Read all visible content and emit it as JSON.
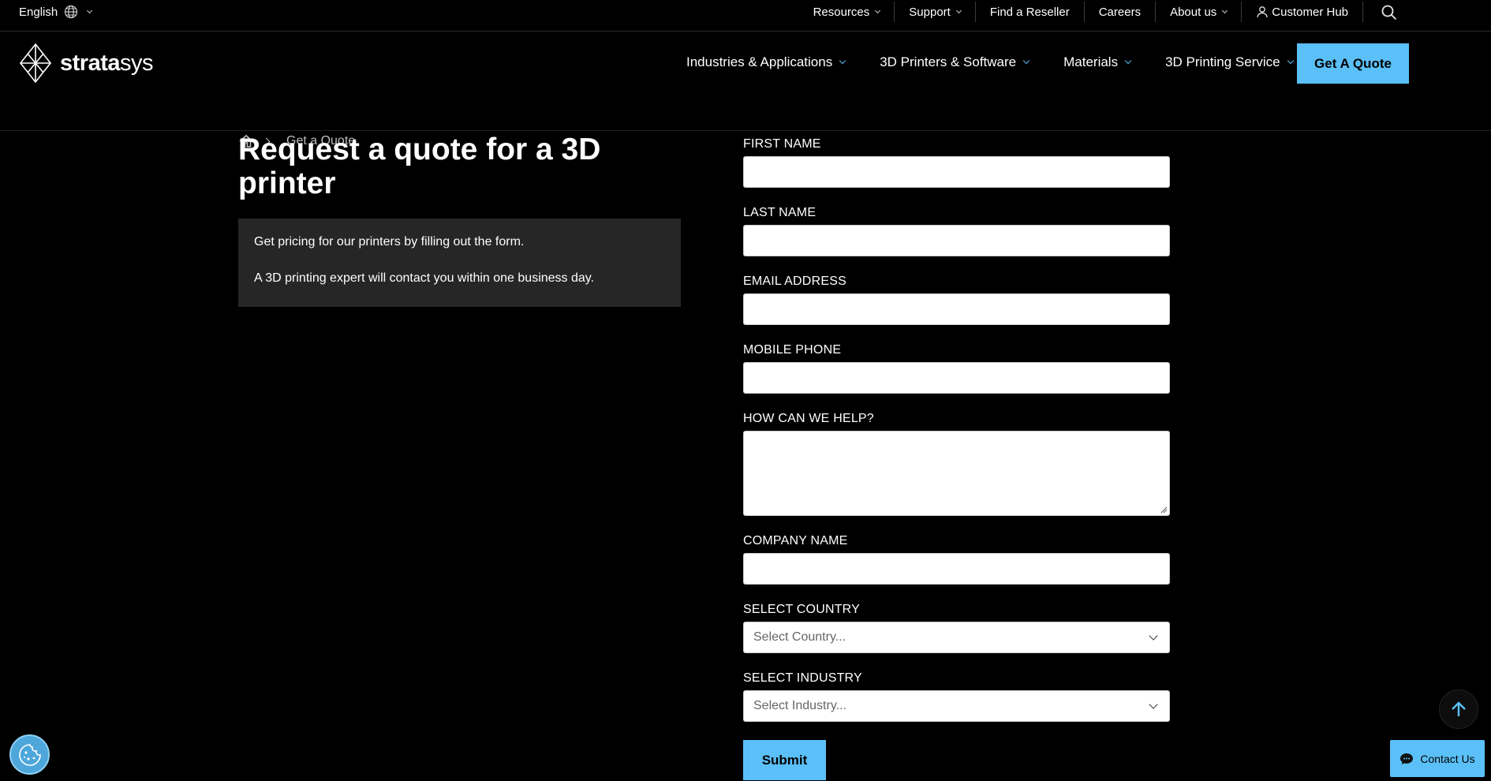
{
  "utility_bar": {
    "language": "English",
    "items": [
      {
        "label": "Resources",
        "dropdown": true
      },
      {
        "label": "Support",
        "dropdown": true
      },
      {
        "label": "Find a Reseller",
        "dropdown": false
      },
      {
        "label": "Careers",
        "dropdown": false
      },
      {
        "label": "About us",
        "dropdown": true
      },
      {
        "label": "Customer Hub",
        "dropdown": false
      }
    ]
  },
  "brand": {
    "name_bold": "strata",
    "name_light": "sys",
    "accent_color": "#5bc0f8"
  },
  "main_nav": {
    "items": [
      "Industries & Applications",
      "3D Printers & Software",
      "Materials",
      "3D Printing Service"
    ],
    "cta_label": "Get A Quote"
  },
  "breadcrumb": {
    "current": "Get a Quote"
  },
  "page": {
    "title": "Request a quote for a 3D printer",
    "intro_line_1": "Get pricing for our printers by filling out the form.",
    "intro_line_2": "A 3D printing expert will contact you within one business day."
  },
  "form": {
    "first_name_label": "FIRST NAME",
    "last_name_label": "LAST NAME",
    "email_label": "EMAIL ADDRESS",
    "phone_label": "MOBILE PHONE",
    "help_label": "HOW CAN WE HELP?",
    "company_label": "COMPANY NAME",
    "country_label": "SELECT COUNTRY",
    "country_placeholder": "Select Country...",
    "industry_label": "SELECT INDUSTRY",
    "industry_placeholder": "Select Industry...",
    "submit_label": "Submit"
  },
  "floating": {
    "contact_label": "Contact Us"
  }
}
